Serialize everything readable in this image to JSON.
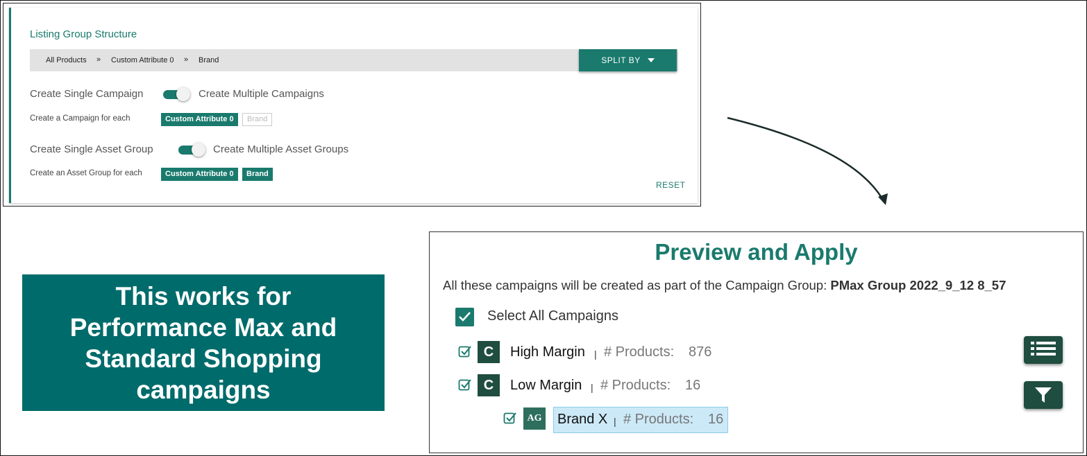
{
  "listing_group": {
    "title": "Listing Group Structure",
    "breadcrumb": [
      "All Products",
      "Custom Attribute 0",
      "Brand"
    ],
    "breadcrumb_separator": "»",
    "split_by_label": "SPLIT BY",
    "campaign_toggle": {
      "left_label": "Create Single Campaign",
      "right_label": "Create Multiple Campaigns",
      "enabled": true
    },
    "campaign_for_each_label": "Create a Campaign for each",
    "campaign_chips": [
      {
        "label": "Custom Attribute 0",
        "selected": true
      },
      {
        "label": "Brand",
        "selected": false
      }
    ],
    "asset_toggle": {
      "left_label": "Create Single Asset Group",
      "right_label": "Create Multiple Asset Groups",
      "enabled": true
    },
    "asset_for_each_label": "Create an Asset Group for each",
    "asset_chips": [
      {
        "label": "Custom Attribute 0",
        "selected": true
      },
      {
        "label": "Brand",
        "selected": true
      }
    ],
    "reset_label": "RESET"
  },
  "banner": {
    "text": "This works for Performance Max and Standard Shopping campaigns"
  },
  "preview": {
    "title": "Preview and Apply",
    "description_prefix": "All these campaigns will be created as part of the Campaign Group: ",
    "group_name": "PMax Group 2022_9_12 8_57",
    "select_all_label": "Select All Campaigns",
    "products_label": "# Products:",
    "pipe": "|",
    "campaign_badge": "C",
    "asset_group_badge": "AG",
    "campaigns": [
      {
        "name": "High Margin",
        "products": "876",
        "expanded": false
      },
      {
        "name": "Low Margin",
        "products": "16",
        "expanded": true
      }
    ],
    "asset_groups": [
      {
        "name": "Brand X",
        "products": "16",
        "selected": true
      }
    ],
    "icons": {
      "list_button": "list-icon",
      "filter_button": "filter-icon"
    }
  },
  "colors": {
    "brand_teal": "#1a7a6d",
    "banner_teal": "#006b6b",
    "dark_green": "#1f4d3f",
    "highlight_blue": "#cce9f7"
  }
}
